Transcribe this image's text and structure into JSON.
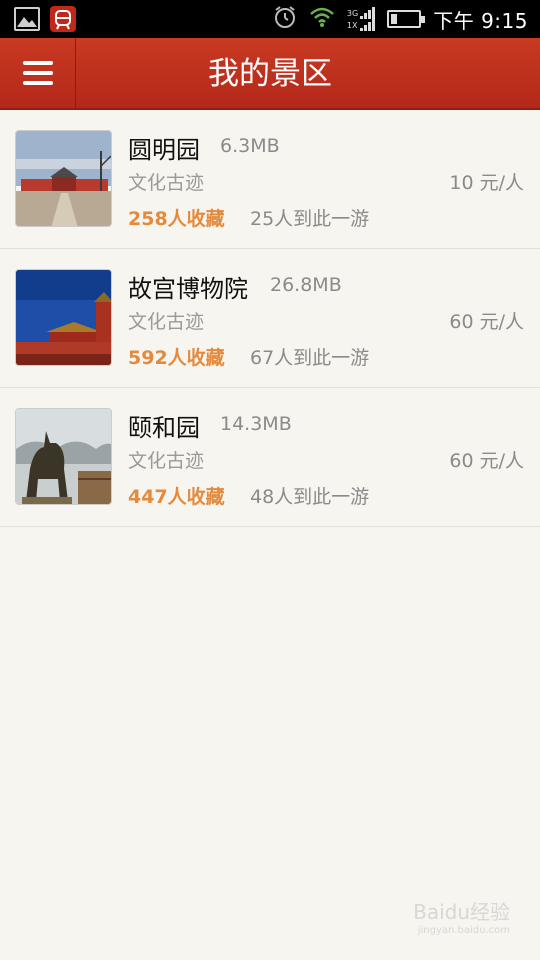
{
  "status_bar": {
    "time": "下午 9:15",
    "network_top": "3G",
    "network_bottom": "1X"
  },
  "header": {
    "title": "我的景区"
  },
  "places": [
    {
      "name": "圆明园",
      "size": "6.3MB",
      "category": "文化古迹",
      "price": "10 元/人",
      "favorites": "258人收藏",
      "visits": "25人到此一游"
    },
    {
      "name": "故宫博物院",
      "size": "26.8MB",
      "category": "文化古迹",
      "price": "60 元/人",
      "favorites": "592人收藏",
      "visits": "67人到此一游"
    },
    {
      "name": "颐和园",
      "size": "14.3MB",
      "category": "文化古迹",
      "price": "60 元/人",
      "favorites": "447人收藏",
      "visits": "48人到此一游"
    }
  ],
  "watermark": {
    "text": "Baidu经验",
    "sub": "jingyan.baidu.com"
  }
}
